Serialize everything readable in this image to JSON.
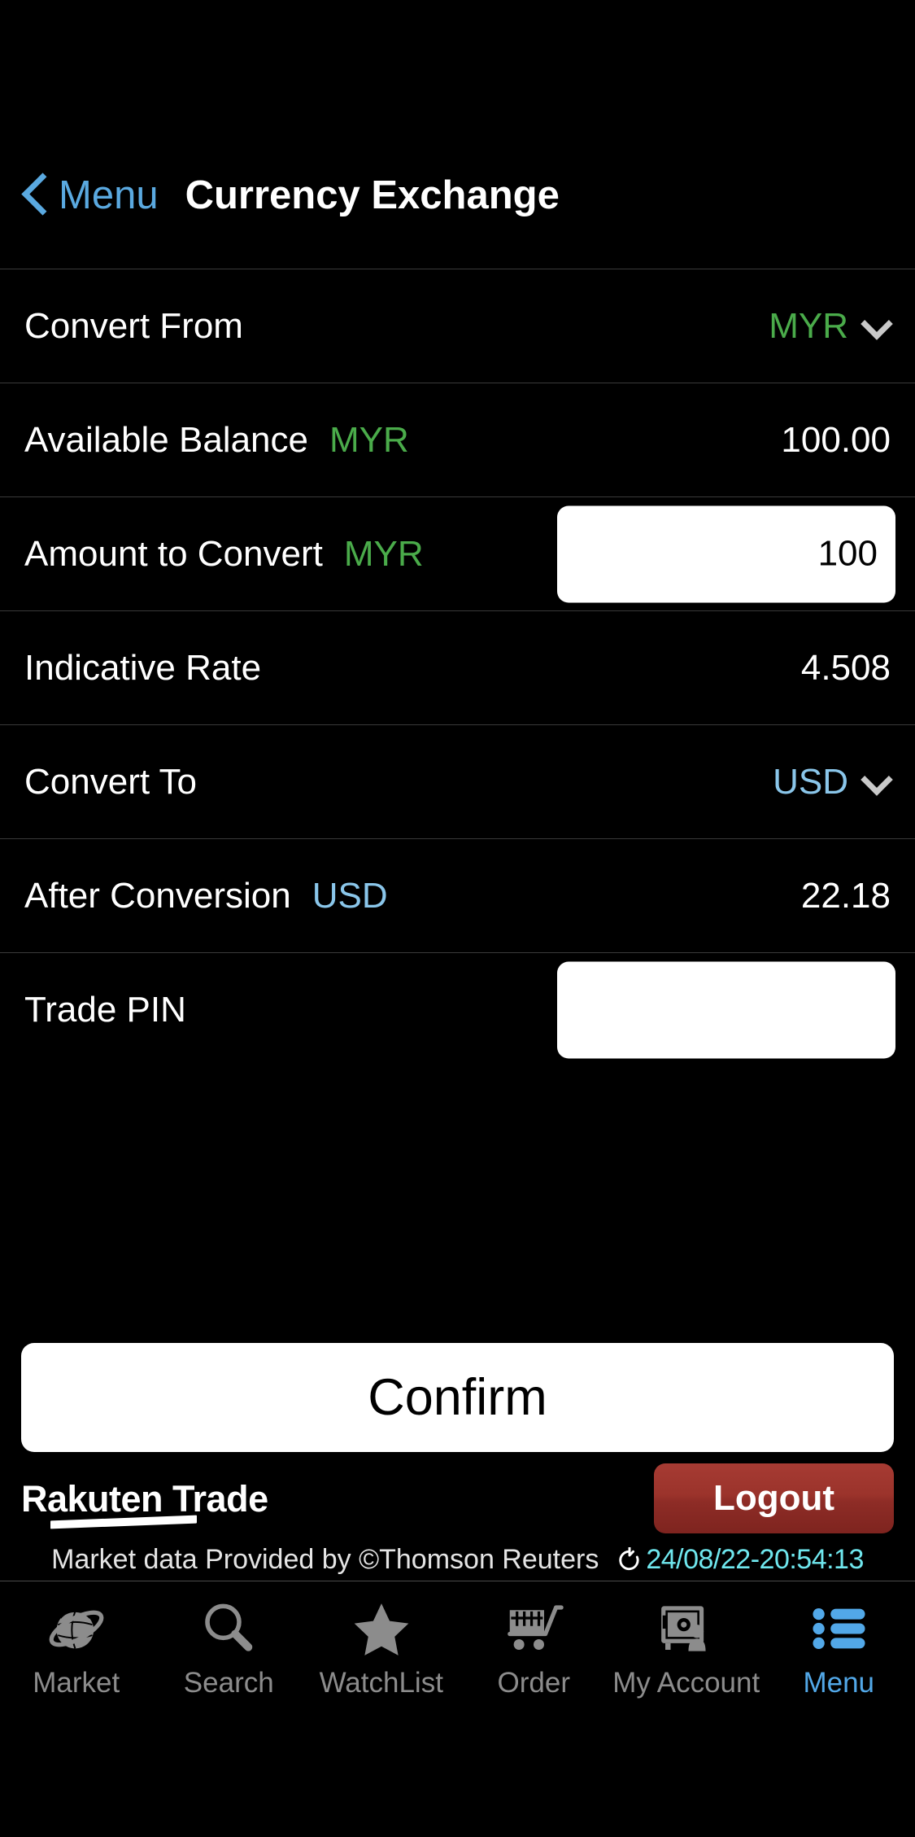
{
  "header": {
    "back_label": "Menu",
    "title": "Currency Exchange",
    "back_icon": "chevron-left-icon"
  },
  "form": {
    "rows": [
      {
        "label": "Convert From",
        "currency": "",
        "value": "MYR",
        "type": "select",
        "value_color": "#4aab4a",
        "icon": "chevron-down-icon"
      },
      {
        "label": "Available Balance",
        "currency": "MYR",
        "value": "100.00",
        "type": "static",
        "currency_color": "#4aab4a"
      },
      {
        "label": "Amount to Convert",
        "currency": "MYR",
        "value": "100",
        "placeholder": "",
        "type": "input",
        "currency_color": "#4aab4a"
      },
      {
        "label": "Indicative Rate",
        "currency": "",
        "value": "4.508",
        "type": "static"
      },
      {
        "label": "Convert To",
        "currency": "",
        "value": "USD",
        "type": "select",
        "value_color": "#8ac6ea",
        "icon": "chevron-down-icon"
      },
      {
        "label": "After Conversion",
        "currency": "USD",
        "value": "22.18",
        "type": "static",
        "currency_color": "#8ac6ea"
      },
      {
        "label": "Trade PIN",
        "currency": "",
        "value": "",
        "placeholder": "",
        "type": "input"
      }
    ]
  },
  "actions": {
    "confirm_label": "Confirm",
    "logout_label": "Logout"
  },
  "brand": {
    "name": "Rakuten Trade"
  },
  "marketdata": {
    "text": "Market data Provided by ©Thomson Reuters",
    "refresh_icon": "refresh-icon",
    "timestamp": "24/08/22-20:54:13",
    "timestamp_color": "#6fe7ee"
  },
  "tabbar": {
    "items": [
      {
        "label": "Market",
        "icon": "globe-icon",
        "active": false
      },
      {
        "label": "Search",
        "icon": "search-icon",
        "active": false
      },
      {
        "label": "WatchList",
        "icon": "star-icon",
        "active": false
      },
      {
        "label": "Order",
        "icon": "cart-icon",
        "active": false
      },
      {
        "label": "My Account",
        "icon": "safe-icon",
        "active": false
      },
      {
        "label": "Menu",
        "icon": "list-icon",
        "active": true
      }
    ],
    "active_color": "#52a8e8",
    "inactive_color": "#8c8c8c"
  }
}
